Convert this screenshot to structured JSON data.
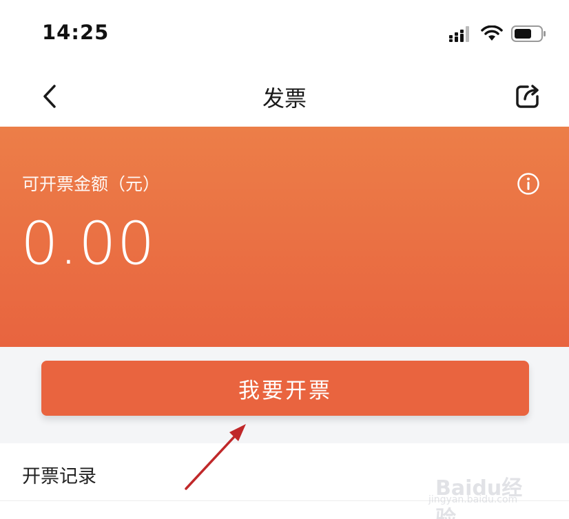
{
  "status_bar": {
    "time": "14:25",
    "icons": [
      "cellular-signal-icon",
      "wifi-icon",
      "battery-icon"
    ]
  },
  "nav": {
    "title": "发票",
    "back_icon": "chevron-left-icon",
    "share_icon": "share-icon"
  },
  "hero": {
    "label": "可开票金额（元）",
    "amount": "0.00",
    "info_icon": "info-icon",
    "gradient_top": "#ec7e48",
    "gradient_bottom": "#e8643f"
  },
  "actions": {
    "issue_invoice_label": "我要开票",
    "button_color": "#e9643f"
  },
  "list": {
    "items": [
      {
        "label": "开票记录"
      }
    ]
  },
  "annotation": {
    "arrow_color": "#c0282a"
  },
  "watermark": {
    "text": "Baidu经验",
    "subtext": "jingyan.baidu.com"
  }
}
